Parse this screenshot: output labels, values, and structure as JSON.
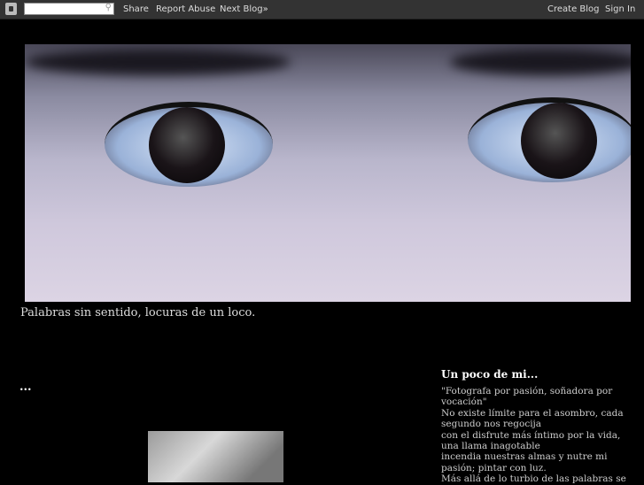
{
  "navbar": {
    "search_placeholder": "",
    "share": "Share",
    "report_abuse": "Report Abuse",
    "next_blog": "Next Blog»",
    "create_blog": "Create Blog",
    "sign_in": "Sign In"
  },
  "blog": {
    "description": "Palabras sin sentido, locuras de un loco.",
    "post_title": "..."
  },
  "sidebar": {
    "title": "Un poco de mi...",
    "lines": [
      "\"Fotografa por pasión, soñadora por vocación\"",
      "No existe límite para el asombro, cada segundo nos regocija",
      "con el disfrute más íntimo por la vida, una llama inagotable",
      "incendia nuestras almas y nutre mi pasión; pintar con luz.",
      "Más allá de lo turbio de las palabras se"
    ]
  }
}
